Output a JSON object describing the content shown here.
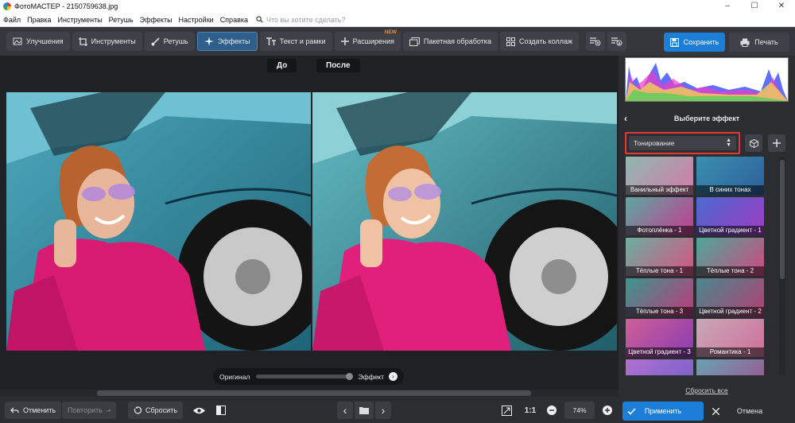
{
  "window": {
    "title": "ФотоМАСТЕР - 2150759638.jpg",
    "min": "–",
    "max": "☐",
    "close": "✕"
  },
  "menu": {
    "items": [
      "Файл",
      "Правка",
      "Инструменты",
      "Ретушь",
      "Эффекты",
      "Настройки",
      "Справка"
    ],
    "search_placeholder": "Что вы хотите сделать?"
  },
  "toolbar": {
    "tabs": [
      "Улучшения",
      "Инструменты",
      "Ретушь",
      "Эффекты",
      "Текст и рамки",
      "Расширения",
      "Пакетная обработка",
      "Создать коллаж"
    ],
    "active_tab": "Эффекты",
    "new_badge": "NEW",
    "save": "Сохранить",
    "print": "Печать"
  },
  "compare": {
    "before": "До",
    "after": "После"
  },
  "slider": {
    "left": "Оригинал",
    "right": "Эффект",
    "value": 1.0
  },
  "bottombar": {
    "undo": "Отменить",
    "redo": "Повторить",
    "reset": "Сбросить",
    "ratio": "1:1",
    "zoom": "74%"
  },
  "panel": {
    "title": "Выберите эффект",
    "category": "Тонирование",
    "effects": [
      "Ванильный эффект",
      "В синих тонах",
      "Фотоплёнка - 1",
      "Цветной градиент - 1",
      "Тёплые тона - 1",
      "Тёплые тона - 2",
      "Тёплые тона - 3",
      "Цветной градиент - 2",
      "Цветной градиент - 3",
      "Романтика - 1",
      "",
      ""
    ],
    "reset_all": "Сбросить все",
    "apply": "Применить",
    "cancel": "Отмена"
  },
  "colors": {
    "accent": "#1c7ed6",
    "highlight_border": "#e53935",
    "new_badge": "#ff8a2a"
  }
}
